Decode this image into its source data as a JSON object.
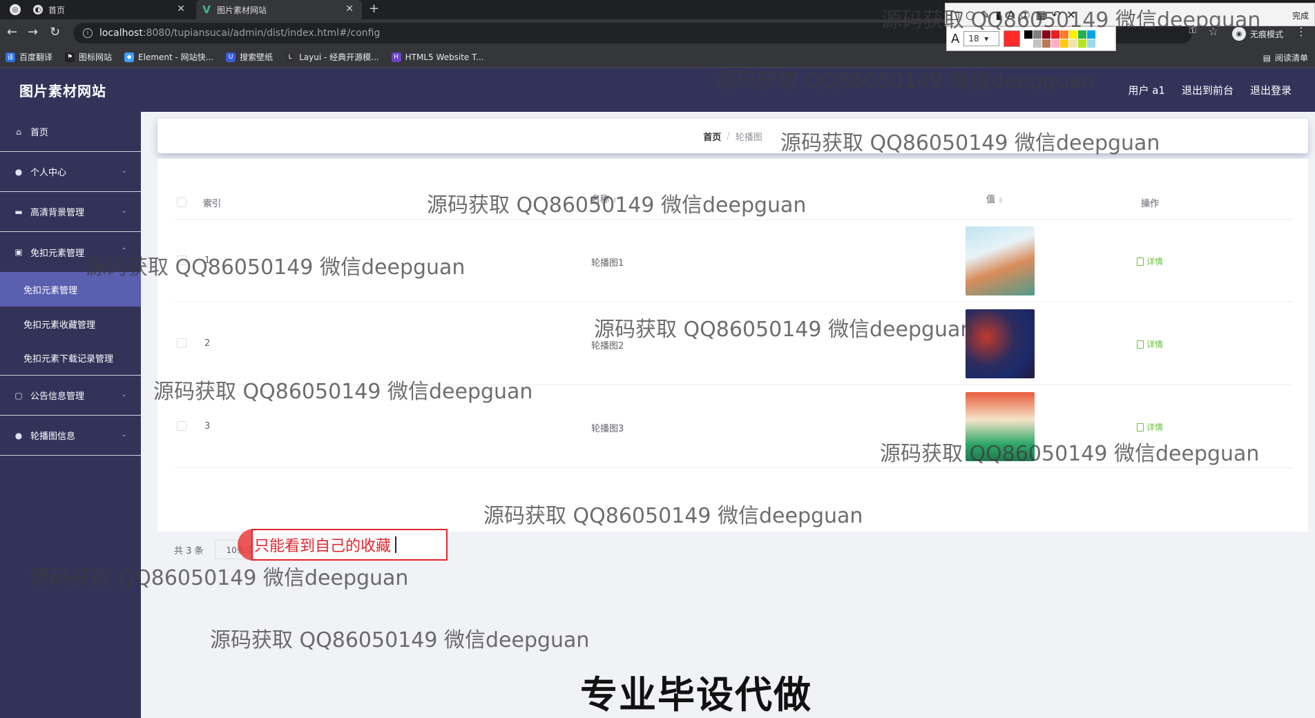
{
  "browser": {
    "tabs": [
      {
        "label": "首页"
      },
      {
        "label": "图片素材网站"
      }
    ],
    "new_tab": "+",
    "url_host": "localhost",
    "url_path": ":8080/tupiansucai/admin/dist/index.html#/config",
    "incognito_label": "无痕模式",
    "bookmarks": [
      {
        "label": "百度翻译",
        "color": "#2b6de5"
      },
      {
        "label": "图标网站",
        "color": "#222222"
      },
      {
        "label": "Element - 网站快...",
        "color": "#409eff"
      },
      {
        "label": "搜索壁纸",
        "color": "#3b5bdb"
      },
      {
        "label": "Layui - 经典开源模...",
        "color": "#333333"
      },
      {
        "label": "HTML5 Website T...",
        "color": "#6f42c1"
      }
    ],
    "reading_list": "阅读清单",
    "draw_toolbar": {
      "font_size": "18",
      "current_color": "#ff2b2b",
      "swatches": [
        "#000000",
        "#7f7f7f",
        "#880015",
        "#ed1c24",
        "#ff7f27",
        "#fff200",
        "#22b14c",
        "#00a2e8",
        "#ffffff",
        "#c3c3c3",
        "#b97a57",
        "#ffaec9",
        "#ffc90e",
        "#efe4b0",
        "#b5e61d",
        "#99d9ea"
      ],
      "done_label": "完成"
    }
  },
  "app": {
    "title": "图片素材网站",
    "header_links": [
      "用户 a1",
      "退出到前台",
      "退出登录"
    ]
  },
  "sidebar": {
    "items": [
      {
        "label": "首页",
        "icon": "home-icon"
      },
      {
        "label": "个人中心",
        "icon": "user-icon"
      },
      {
        "label": "高清背景管理",
        "icon": "monitor-icon"
      },
      {
        "label": "免扣元素管理",
        "icon": "box-icon"
      }
    ],
    "sub_items": [
      "免扣元素管理",
      "免扣元素收藏管理",
      "免扣元素下载记录管理"
    ],
    "items_after": [
      {
        "label": "公告信息管理",
        "icon": "square-icon"
      },
      {
        "label": "轮播图信息",
        "icon": "user-icon"
      }
    ]
  },
  "breadcrumb": {
    "home": "首页",
    "current": "轮播图"
  },
  "table": {
    "headers": {
      "index": "索引",
      "name": "名称",
      "value": "值",
      "action": "操作"
    },
    "rows": [
      {
        "index": "1",
        "name": "轮播图1",
        "action": "详情"
      },
      {
        "index": "2",
        "name": "轮播图2",
        "action": "详情"
      },
      {
        "index": "3",
        "name": "轮播图3",
        "action": "详情"
      }
    ]
  },
  "pagination": {
    "total": "共 3 条",
    "page_size": "10条/页",
    "current_page": "1",
    "goto_label": "前往",
    "goto_value": "1",
    "page_unit": "页"
  },
  "annotation": {
    "text": "只能看到自己的收藏"
  },
  "watermark": "源码获取 QQ86050149 微信deepguan",
  "banner": "专业毕设代做"
}
